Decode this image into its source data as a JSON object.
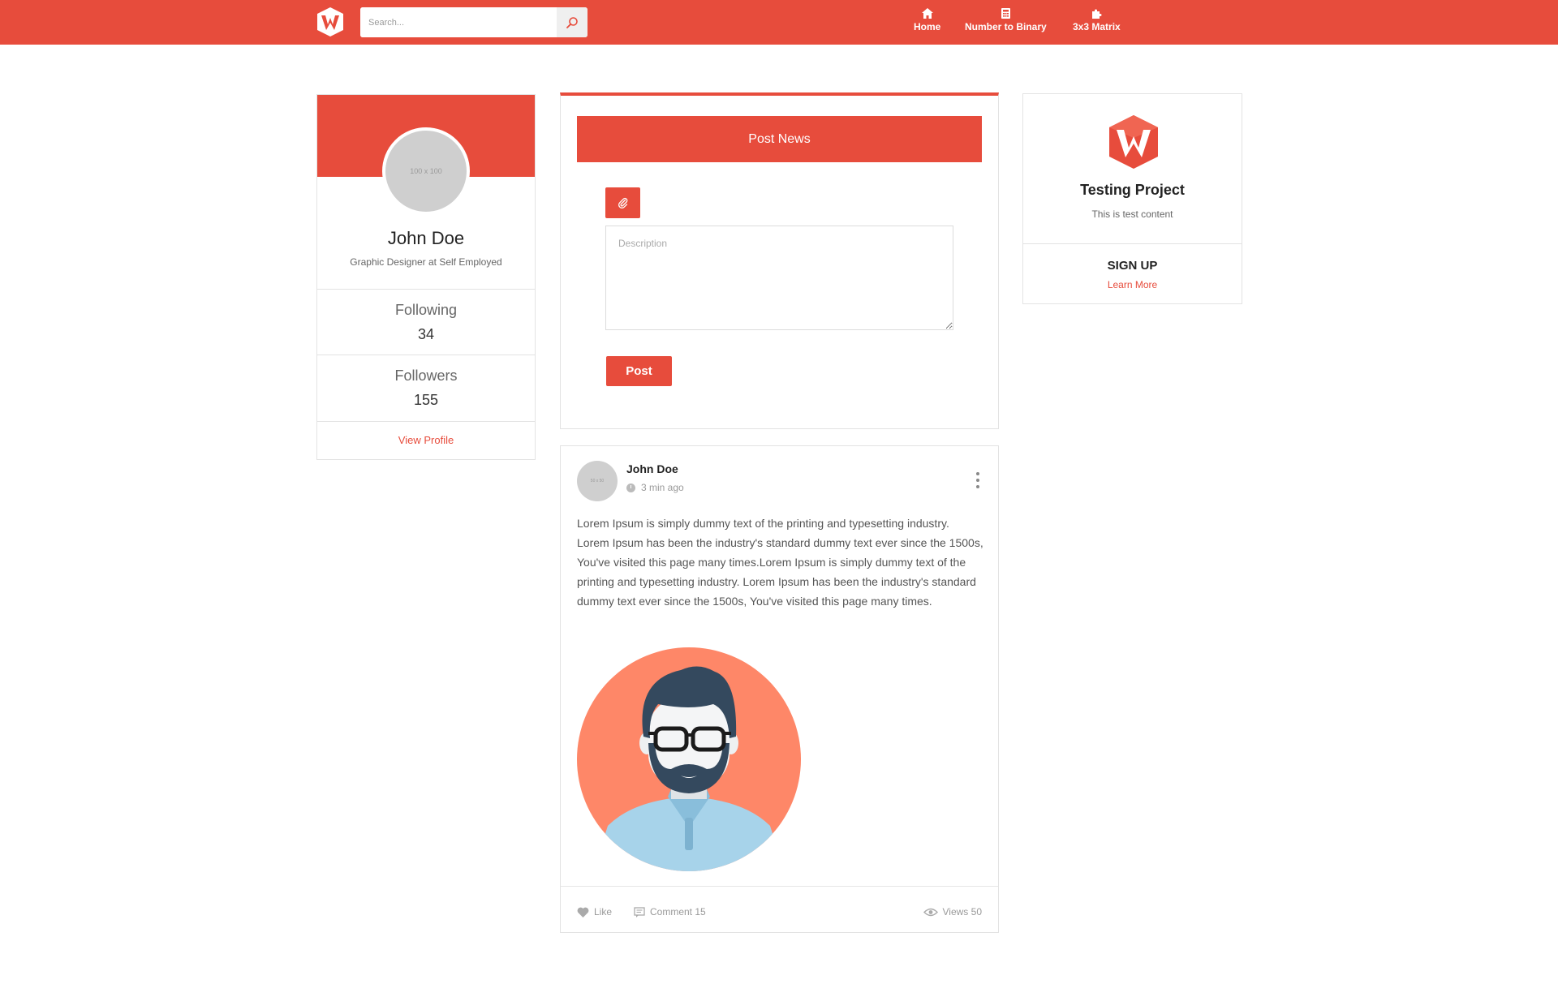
{
  "theme": {
    "accent": "#e74c3c",
    "avatar_placeholder": "#cfcfcf",
    "post_image_bg": "#fe8768"
  },
  "header": {
    "logo_icon": "w-logo-icon",
    "search": {
      "placeholder": "Search...",
      "value": "",
      "icon": "search-icon"
    },
    "nav": [
      {
        "label": "Home",
        "icon": "home-icon"
      },
      {
        "label": "Number to Binary",
        "icon": "calculator-icon"
      },
      {
        "label": "3x3 Matrix",
        "icon": "puzzle-icon"
      }
    ]
  },
  "profile": {
    "avatar_placeholder": "100 x 100",
    "name": "John Doe",
    "role": "Graphic Designer at Self Employed",
    "stats": [
      {
        "label": "Following",
        "value": "34"
      },
      {
        "label": "Followers",
        "value": "155"
      }
    ],
    "view_profile": "View Profile"
  },
  "composer": {
    "header_label": "Post News",
    "attach_icon": "paperclip-icon",
    "description_placeholder": "Description",
    "description_value": "",
    "post_label": "Post"
  },
  "feed_post": {
    "avatar_placeholder": "50 x 50",
    "author": "John Doe",
    "time": "3 min ago",
    "body": "Lorem Ipsum is simply dummy text of the printing and typesetting industry. Lorem Ipsum has been the industry's standard dummy text ever since the 1500s, You've visited this page many times.Lorem Ipsum is simply dummy text of the printing and typesetting industry. Lorem Ipsum has been the industry's standard dummy text ever since the 1500s, You've visited this page many times.",
    "image": "man-with-glasses-avatar-illustration",
    "actions": {
      "like": "Like",
      "comment": "Comment 15",
      "views": "Views 50"
    }
  },
  "promo": {
    "logo_icon": "w-logo-icon",
    "title": "Testing Project",
    "subtitle": "This is test content",
    "cta": "SIGN UP",
    "link": "Learn More"
  }
}
